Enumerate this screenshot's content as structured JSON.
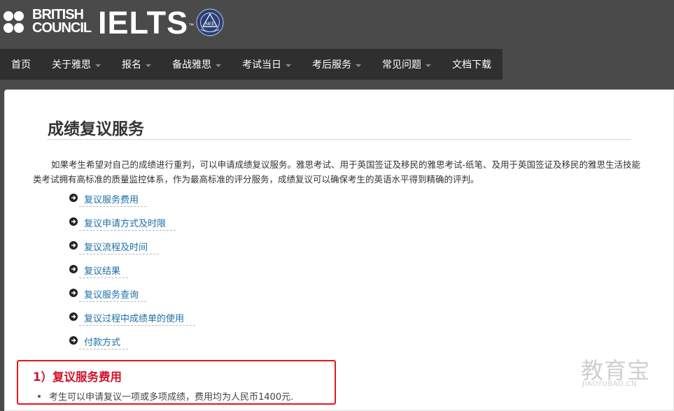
{
  "header": {
    "brand_line1": "BRITISH",
    "brand_line2": "COUNCIL",
    "product": "IELTS",
    "trademark": "™",
    "seal_text": "NEE"
  },
  "nav": {
    "items": [
      {
        "label": "首页",
        "has_dropdown": false
      },
      {
        "label": "关于雅思",
        "has_dropdown": true
      },
      {
        "label": "报名",
        "has_dropdown": true
      },
      {
        "label": "备战雅思",
        "has_dropdown": true
      },
      {
        "label": "考试当日",
        "has_dropdown": true
      },
      {
        "label": "考后服务",
        "has_dropdown": true
      },
      {
        "label": "常见问题",
        "has_dropdown": true
      },
      {
        "label": "文档下载",
        "has_dropdown": false
      }
    ],
    "caret_icon": "caret-down-icon"
  },
  "main": {
    "title": "成绩复议服务",
    "intro": "如果考生希望对自己的成绩进行重判，可以申请成绩复议服务。雅思考试、用于英国签证及移民的雅思考试-纸笔、及用于英国签证及移民的雅思生活技能类考试拥有高标准的质量监控体系，作为最高标准的评分服务，成绩复议可以确保考生的英语水平得到精确的评判。",
    "toc": [
      {
        "label": "复议服务费用"
      },
      {
        "label": "复议申请方式及时限"
      },
      {
        "label": "复议流程及时间"
      },
      {
        "label": "复议结果"
      },
      {
        "label": "复议服务查询"
      },
      {
        "label": "复议过程中成绩单的使用"
      },
      {
        "label": "付款方式"
      }
    ],
    "section": {
      "heading": "1）复议服务费用",
      "bullet": "考生可以申请复议一项或多项成绩，费用均为人民币1400元."
    }
  },
  "watermark": {
    "text": "教育宝",
    "url": "JIAOYUBAO.CN"
  },
  "colors": {
    "header_bg": "#4a4a4a",
    "nav_bg": "#2f2f2f",
    "link": "#1b6fa8",
    "highlight_red": "#e8141e",
    "heading_red": "#d0152b"
  }
}
